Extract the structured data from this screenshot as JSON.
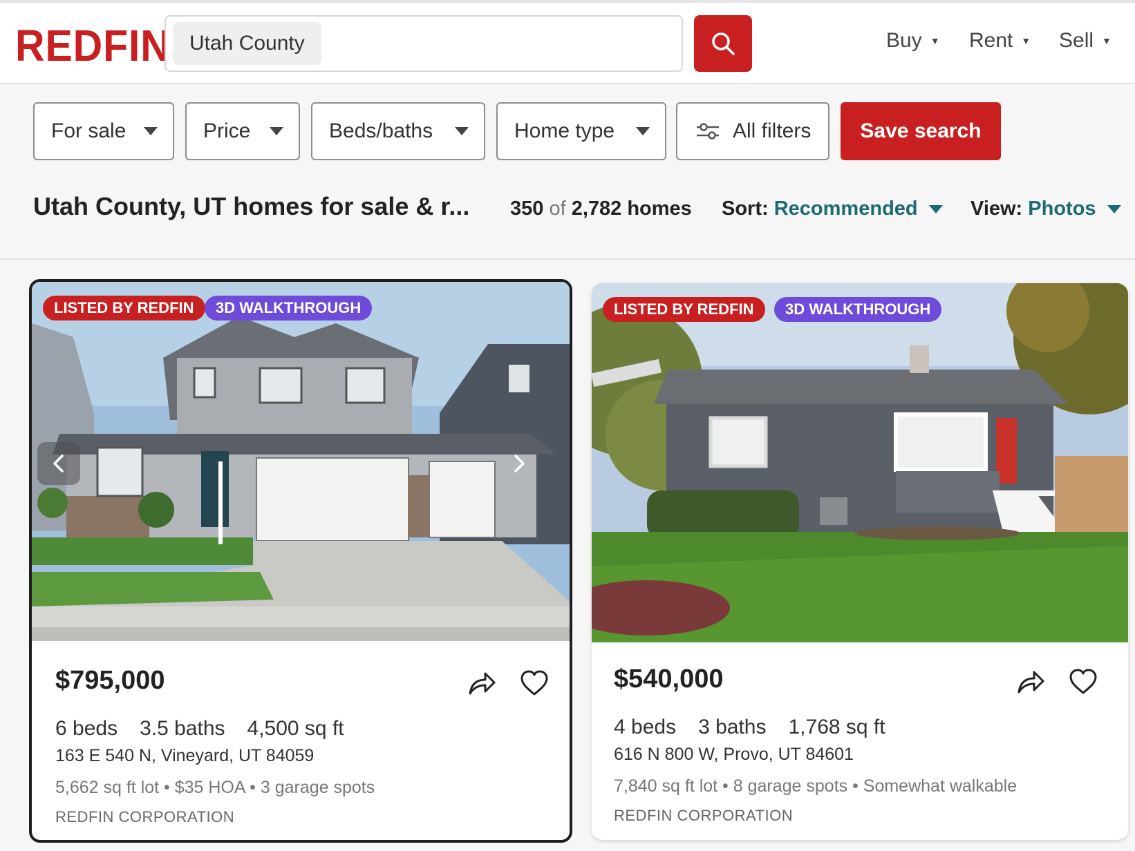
{
  "header": {
    "logo": "REDFIN",
    "search_value": "Utah County",
    "nav": [
      {
        "label": "Buy"
      },
      {
        "label": "Rent"
      },
      {
        "label": "Sell"
      }
    ]
  },
  "filters": {
    "for_sale": "For sale",
    "price": "Price",
    "beds_baths": "Beds/baths",
    "home_type": "Home type",
    "all_filters": "All filters",
    "save_search": "Save search"
  },
  "results": {
    "title": "Utah County, UT homes for sale & r...",
    "shown": "350",
    "of": "of",
    "total": "2,782 homes",
    "sort_label": "Sort:",
    "sort_value": "Recommended",
    "view_label": "View:",
    "view_value": "Photos"
  },
  "listings": [
    {
      "badge_1": "LISTED BY REDFIN",
      "badge_2": "3D WALKTHROUGH",
      "price": "$795,000",
      "beds": "6 beds",
      "baths": "3.5 baths",
      "sqft": "4,500 sq ft",
      "address": "163 E 540 N, Vineyard, UT 84059",
      "extras": "5,662 sq ft lot • $35 HOA • 3 garage spots",
      "broker": "REDFIN CORPORATION"
    },
    {
      "badge_1": "LISTED BY REDFIN",
      "badge_2": "3D WALKTHROUGH",
      "price": "$540,000",
      "beds": "4 beds",
      "baths": "3 baths",
      "sqft": "1,768 sq ft",
      "address": "616 N 800 W, Provo, UT 84601",
      "extras": "7,840 sq ft lot • 8 garage spots • Somewhat walkable",
      "broker": "REDFIN CORPORATION"
    }
  ],
  "colors": {
    "brand_red": "#c82021",
    "accent_teal": "#1f6a72",
    "walkthrough_purple": "#6e4bd8"
  },
  "icons": [
    "search-icon",
    "caret-down-icon",
    "sliders-icon",
    "chevron-left-icon",
    "chevron-right-icon",
    "share-icon",
    "heart-icon"
  ]
}
